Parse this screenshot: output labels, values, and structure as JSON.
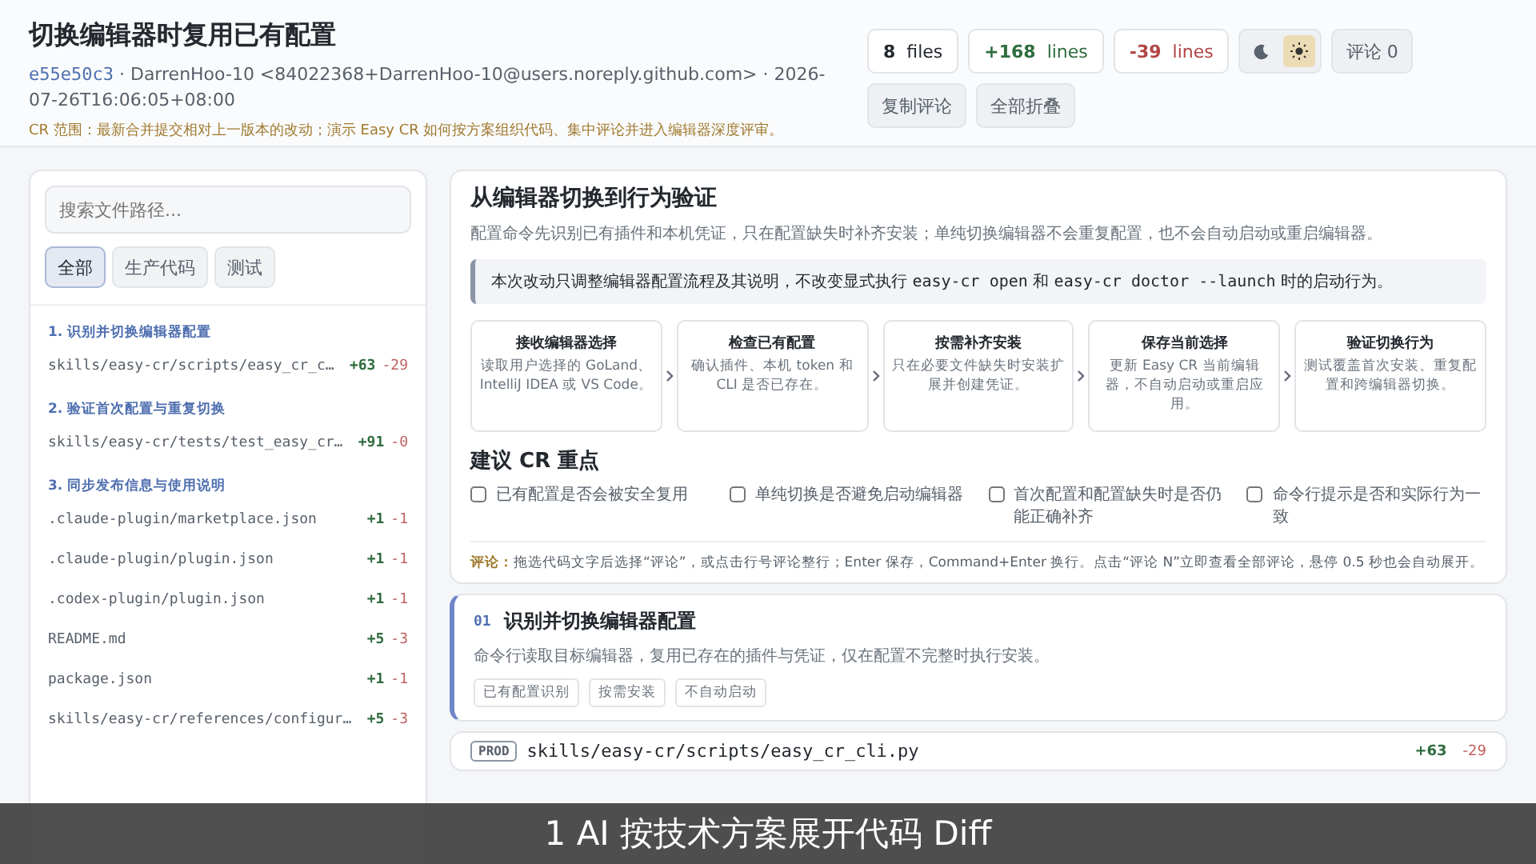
{
  "header": {
    "title": "切换编辑器时复用已有配置",
    "commit": "e55e50c3",
    "meta": "· DarrenHoo-10 <84022368+DarrenHoo-10@users.noreply.github.com> · 2026-07-26T16:06:05+08:00",
    "scope": "CR 范围：最新合并提交相对上一版本的改动；演示 Easy CR 如何按方案组织代码、集中评论并进入编辑器深度评审。"
  },
  "stats": [
    {
      "kind": "files",
      "value": "8",
      "unit": "files"
    },
    {
      "kind": "added",
      "value": "+168",
      "unit": "lines"
    },
    {
      "kind": "removed",
      "value": "-39",
      "unit": "lines"
    }
  ],
  "theme": [
    {
      "kind": "moon",
      "selected": false
    },
    {
      "kind": "sun",
      "selected": true
    }
  ],
  "actions": [
    "评论 0",
    "复制评论",
    "全部折叠"
  ],
  "sidebar": {
    "search_placeholder": "搜索文件路径...",
    "filters": [
      {
        "label": "全部",
        "selected": true
      },
      {
        "label": "生产代码",
        "selected": false
      },
      {
        "label": "测试",
        "selected": false
      }
    ],
    "groups": [
      {
        "title": "1. 识别并切换编辑器配置",
        "files": [
          {
            "path": "skills/easy-cr/scripts/easy_cr_c…",
            "added": "+63",
            "removed": "-29"
          }
        ]
      },
      {
        "title": "2. 验证首次配置与重复切换",
        "files": [
          {
            "path": "skills/easy-cr/tests/test_easy_cr…",
            "added": "+91",
            "removed": "-0"
          }
        ]
      },
      {
        "title": "3. 同步发布信息与使用说明",
        "files": [
          {
            "path": ".claude-plugin/marketplace.json",
            "added": "+1",
            "removed": "-1"
          },
          {
            "path": ".claude-plugin/plugin.json",
            "added": "+1",
            "removed": "-1"
          },
          {
            "path": ".codex-plugin/plugin.json",
            "added": "+1",
            "removed": "-1"
          },
          {
            "path": "README.md",
            "added": "+5",
            "removed": "-3"
          },
          {
            "path": "package.json",
            "added": "+1",
            "removed": "-1"
          },
          {
            "path": "skills/easy-cr/references/configur…",
            "added": "+5",
            "removed": "-3"
          }
        ]
      }
    ]
  },
  "overview": {
    "title": "从编辑器切换到行为验证",
    "description": "配置命令先识别已有插件和本机凭证，只在配置缺失时补齐安装；单纯切换编辑器不会重复配置，也不会自动启动或重启编辑器。",
    "note": [
      {
        "kind": "text",
        "text": "本次改动只调整编辑器配置流程及其说明，不改变显式执行 "
      },
      {
        "kind": "code",
        "text": "easy-cr open"
      },
      {
        "kind": "text",
        "text": " 和 "
      },
      {
        "kind": "code",
        "text": "easy-cr doctor --launch"
      },
      {
        "kind": "text",
        "text": " 时的启动行为。"
      }
    ],
    "steps": [
      {
        "title": "接收编辑器选择",
        "text": "读取用户选择的 GoLand、IntelliJ IDEA 或 VS Code。"
      },
      {
        "title": "检查已有配置",
        "text": "确认插件、本机 token 和 CLI 是否已存在。"
      },
      {
        "title": "按需补齐安装",
        "text": "只在必要文件缺失时安装扩展并创建凭证。"
      },
      {
        "title": "保存当前选择",
        "text": "更新 Easy CR 当前编辑器，不自动启动或重启应用。"
      },
      {
        "title": "验证切换行为",
        "text": "测试覆盖首次安装、重复配置和跨编辑器切换。"
      }
    ],
    "focus_title": "建议 CR 重点",
    "focus": [
      {
        "label": "已有配置是否会被安全复用",
        "checked": false
      },
      {
        "label": "单纯切换是否避免启动编辑器",
        "checked": false
      },
      {
        "label": "首次配置和配置缺失时是否仍能正确补齐",
        "checked": false
      },
      {
        "label": "命令行提示是否和实际行为一致",
        "checked": false
      }
    ],
    "hint_label": "评论：",
    "hint": "拖选代码文字后选择“评论”，或点击行号评论整行；Enter 保存，Command+Enter 换行。点击“评论 N”立即查看全部评论，悬停 0.5 秒也会自动展开。"
  },
  "section": {
    "number": "01",
    "title": "识别并切换编辑器配置",
    "text": "命令行读取目标编辑器，复用已存在的插件与凭证，仅在配置不完整时执行安装。",
    "tags": [
      "已有配置识别",
      "按需安装",
      "不自动启动"
    ]
  },
  "file": {
    "tag": "PROD",
    "path": "skills/easy-cr/scripts/easy_cr_cli.py",
    "added": "+63",
    "removed": "-29"
  },
  "caption": "1  AI 按技术方案展开代码 Diff"
}
